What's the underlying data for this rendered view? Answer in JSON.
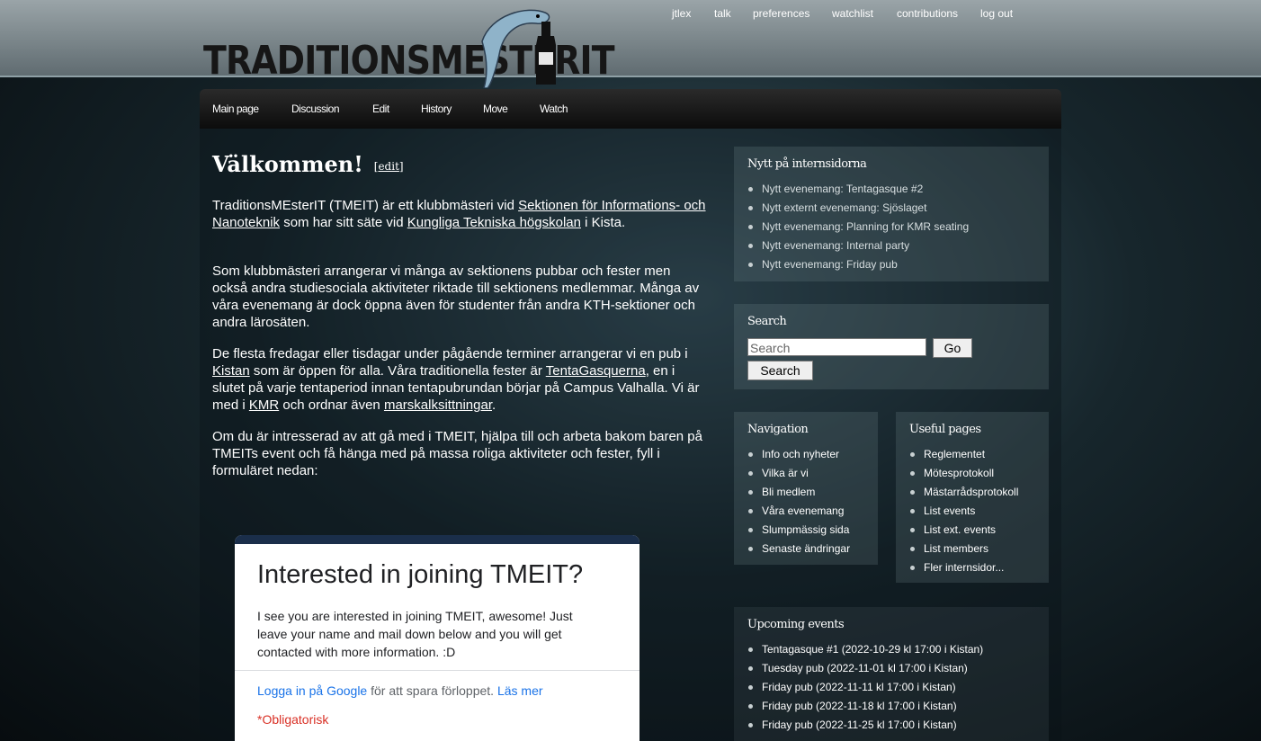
{
  "header": {
    "logo_text": "TRADITIONSMESTERIT",
    "user_links": [
      "jtlex",
      "talk",
      "preferences",
      "watchlist",
      "contributions",
      "log out"
    ]
  },
  "tabs": [
    "Main page",
    "Discussion",
    "Edit",
    "History",
    "Move",
    "Watch"
  ],
  "content": {
    "title": "Välkommen!",
    "edit_label": "edit",
    "p1": {
      "t1": "TraditionsMEsterIT (TMEIT) är ett klubbmästeri vid ",
      "l1": "Sektionen för Informations- och Nanoteknik",
      "t2": " som har sitt säte vid ",
      "l2": "Kungliga Tekniska högskolan",
      "t3": " i Kista."
    },
    "p2": "Som klubbmästeri arrangerar vi många av sektionens pubbar och fester men också andra studiesociala aktiviteter riktade till sektionens medlemmar. Många av våra evenemang är dock öppna även för studenter från andra KTH-sektioner och andra lärosäten.",
    "p3": {
      "t1": "De flesta fredagar eller tisdagar under pågående terminer arrangerar vi en pub i ",
      "l1": "Kistan",
      "t2": " som är öppen för alla. Våra traditionella fester är ",
      "l2": "TentaGasquerna",
      "t3": ", en i slutet på varje tentaperiod innan tentapubrundan börjar på Campus Valhalla. Vi är med i ",
      "l3": "KMR",
      "t4": " och ordnar även ",
      "l4": "marskalksittningar",
      "t5": "."
    },
    "p4": "Om du är intresserad av att gå med i TMEIT, hjälpa till och arbeta bakom baren på TMEITs event och få hänga med på massa roliga aktiviteter och fester, fyll i formuläret nedan:"
  },
  "form": {
    "title": "Interested in joining TMEIT?",
    "description": "I see you are interested in joining TMEIT, awesome! Just leave your name and mail down below and you will get contacted with more information. :D",
    "login_link": "Logga in på Google",
    "login_text": " för att spara förloppet. ",
    "read_more": "Läs mer",
    "required": "*Obligatorisk"
  },
  "news": {
    "title": "Nytt på internsidorna",
    "items": [
      "Nytt evenemang: Tentagasque #2",
      "Nytt externt evenemang: Sjöslaget",
      "Nytt evenemang: Planning for KMR seating",
      "Nytt evenemang: Internal party",
      "Nytt evenemang: Friday pub"
    ]
  },
  "search": {
    "title": "Search",
    "placeholder": "Search",
    "go_label": "Go",
    "search_label": "Search"
  },
  "navigation": {
    "title": "Navigation",
    "items": [
      "Info och nyheter",
      "Vilka är vi",
      "Bli medlem",
      "Våra evenemang",
      "Slumpmässig sida",
      "Senaste ändringar"
    ]
  },
  "useful": {
    "title": "Useful pages",
    "items": [
      "Reglementet",
      "Mötesprotokoll",
      "Mästarrådsprotokoll",
      "List events",
      "List ext. events",
      "List members",
      "Fler internsidor..."
    ]
  },
  "upcoming": {
    "title": "Upcoming events",
    "items": [
      "Tentagasque #1 (2022-10-29 kl 17:00 i Kistan)",
      "Tuesday pub (2022-11-01 kl 17:00 i Kistan)",
      "Friday pub (2022-11-11 kl 17:00 i Kistan)",
      "Friday pub (2022-11-18 kl 17:00 i Kistan)",
      "Friday pub (2022-11-25 kl 17:00 i Kistan)"
    ]
  }
}
